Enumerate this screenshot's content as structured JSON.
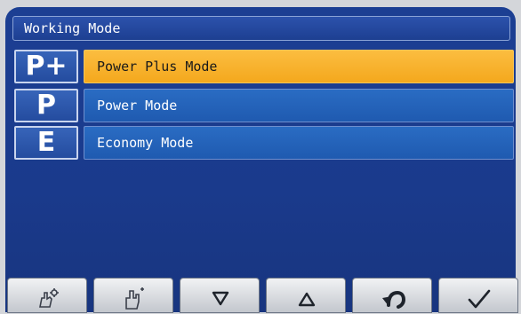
{
  "header": {
    "title": "Working Mode"
  },
  "modes": [
    {
      "icon_text": "P+",
      "label": "Power Plus Mode",
      "selected": true
    },
    {
      "icon_text": "P",
      "label": "Power Mode",
      "selected": false
    },
    {
      "icon_text": "E",
      "label": "Economy Mode",
      "selected": false
    }
  ],
  "toolbar": {
    "buttons": [
      {
        "icon": "settings-hand-icon"
      },
      {
        "icon": "hand-touch-icon"
      },
      {
        "icon": "down-arrow-icon"
      },
      {
        "icon": "up-arrow-icon"
      },
      {
        "icon": "back-return-icon"
      },
      {
        "icon": "check-icon"
      }
    ]
  },
  "colors": {
    "screen_bg": "#1a3a8c",
    "selected_bar": "#f4a81d",
    "mode_bar": "#2166ba",
    "toolbar_button": "#e2e4e8"
  }
}
